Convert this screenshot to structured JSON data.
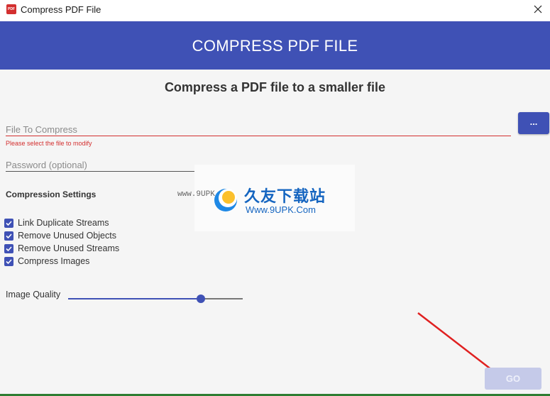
{
  "window": {
    "title": "Compress PDF File",
    "app_icon_text": "PDF",
    "close_glyph": "×"
  },
  "header": {
    "title": "COMPRESS PDF FILE"
  },
  "main": {
    "subtitle": "Compress a PDF file to a smaller file",
    "file_field": {
      "placeholder": "File To Compress",
      "value": "",
      "error": "Please select the file to modify"
    },
    "browse_button": {
      "label": "..."
    },
    "password_field": {
      "placeholder": "Password (optional)",
      "value": ""
    },
    "compression_settings": {
      "title": "Compression Settings",
      "options": [
        {
          "label": "Link Duplicate Streams",
          "checked": true
        },
        {
          "label": "Remove Unused Objects",
          "checked": true
        },
        {
          "label": "Remove Unused Streams",
          "checked": true
        },
        {
          "label": "Compress Images",
          "checked": true
        }
      ]
    },
    "image_quality": {
      "label": "Image Quality",
      "value_fraction": 0.76
    },
    "go_button": {
      "label": "GO",
      "enabled": false
    }
  },
  "watermark": {
    "url_text": "www.9UPK.com",
    "chinese_text": "久友下载站",
    "domain_text": "Www.9UPK.Com"
  },
  "colors": {
    "primary": "#3f51b5",
    "error": "#d32f2f",
    "disabled_button": "#c5cae9",
    "annotation_arrow": "#e02020"
  }
}
